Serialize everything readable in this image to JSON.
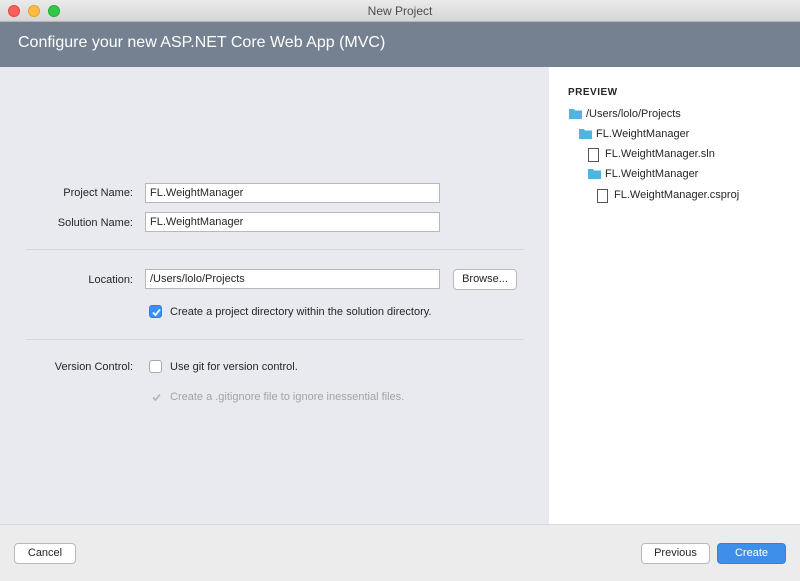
{
  "window": {
    "title": "New Project"
  },
  "header": {
    "title": "Configure your new ASP.NET Core Web App (MVC)"
  },
  "form": {
    "project_name_label": "Project Name:",
    "project_name_value": "FL.WeightManager",
    "solution_name_label": "Solution Name:",
    "solution_name_value": "FL.WeightManager",
    "location_label": "Location:",
    "location_value": "/Users/lolo/Projects",
    "browse_label": "Browse...",
    "create_dir_label": "Create a project directory within the solution directory.",
    "create_dir_checked": true,
    "version_control_label": "Version Control:",
    "use_git_label": "Use git for version control.",
    "use_git_checked": false,
    "gitignore_label": "Create a .gitignore file to ignore inessential files.",
    "gitignore_checked": true,
    "gitignore_disabled": true
  },
  "preview": {
    "title": "PREVIEW",
    "tree": [
      {
        "type": "folder-icon",
        "name": "/Users/lolo/Projects"
      },
      {
        "type": "folder-icon",
        "name": "FL.WeightManager"
      },
      {
        "type": "file-icon",
        "name": "FL.WeightManager.sln"
      },
      {
        "type": "folder-icon",
        "name": "FL.WeightManager"
      },
      {
        "type": "file-icon",
        "name": "FL.WeightManager.csproj"
      }
    ]
  },
  "footer": {
    "cancel_label": "Cancel",
    "previous_label": "Previous",
    "create_label": "Create"
  },
  "colors": {
    "accent": "#3e8fea",
    "folder": "#4fb5de",
    "header_bg": "#758190"
  }
}
